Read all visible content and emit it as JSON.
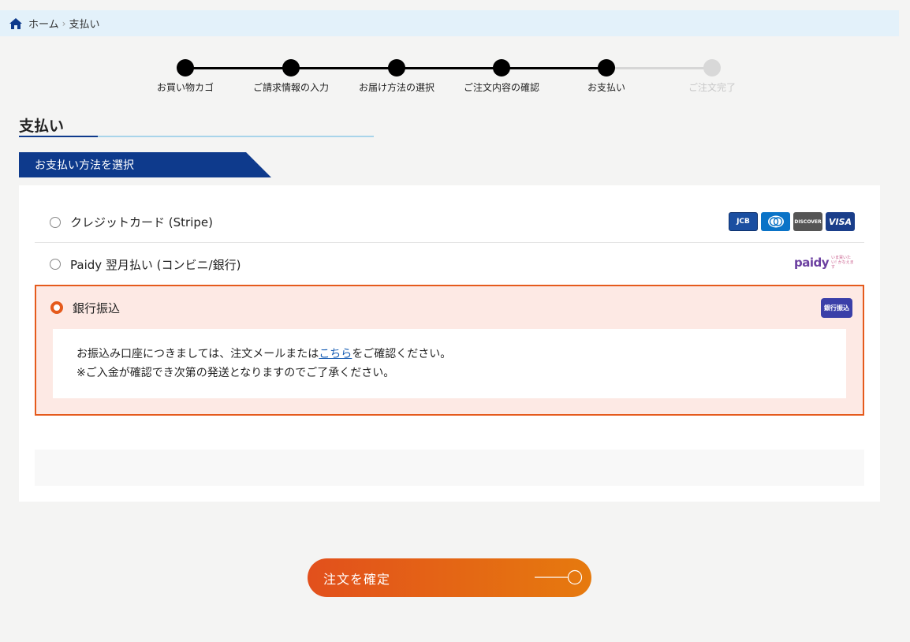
{
  "breadcrumb": {
    "home": "ホーム",
    "separator": "›",
    "current": "支払い"
  },
  "steps": [
    {
      "label": "お買い物カゴ",
      "state": "done"
    },
    {
      "label": "ご請求情報の入力",
      "state": "done"
    },
    {
      "label": "お届け方法の選択",
      "state": "done"
    },
    {
      "label": "ご注文内容の確認",
      "state": "done"
    },
    {
      "label": "お支払い",
      "state": "current"
    },
    {
      "label": "ご注文完了",
      "state": "todo"
    }
  ],
  "page_title": "支払い",
  "section_title": "お支払い方法を選択",
  "methods": {
    "credit": {
      "label": "クレジットカード (Stripe)",
      "logos": {
        "jcb": "JCB",
        "diners": "Diners",
        "discover": "DISCOVER",
        "visa": "VISA"
      }
    },
    "paidy": {
      "label": "Paidy 翌月払い (コンビニ/銀行)",
      "logo": "paidy",
      "logo_sub": "いま買いたい! かなえます"
    },
    "bank": {
      "label": "銀行振込",
      "badge": "銀行振込",
      "info_line1_pre": "お振込み口座につきましては、注文メールまたは",
      "info_link": "こちら",
      "info_line1_post": "をご確認ください。",
      "info_line2": "※ご入金が確認でき次第の発送となりますのでご了承ください。"
    }
  },
  "selected_method": "bank",
  "confirm_button": "注文を確定",
  "colors": {
    "brand_navy": "#0e3a8c",
    "accent_orange": "#e55a1c",
    "breadcrumb_bg": "#e3f1fa"
  }
}
